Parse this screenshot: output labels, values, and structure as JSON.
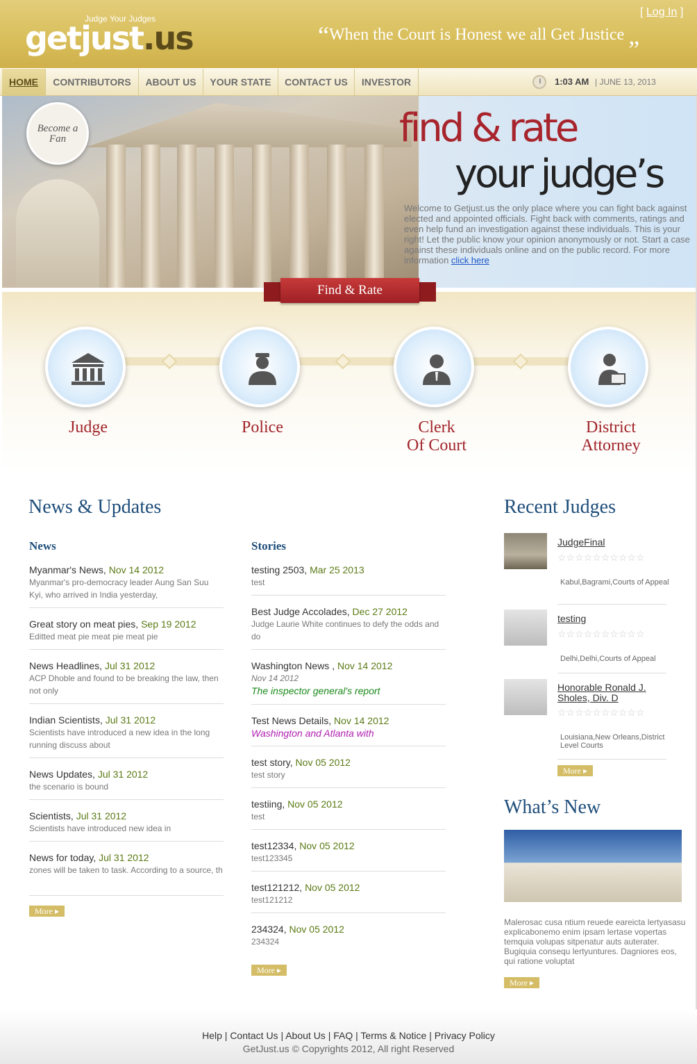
{
  "header": {
    "logo_main": "getjust",
    "logo_tld": ".us",
    "tagline": "Judge Your Judges",
    "quote_open": "“",
    "quote": "When the Court is Honest we all Get Justice",
    "quote_close": "„",
    "login_open": "[ ",
    "login": "Log In",
    "login_close": " ]"
  },
  "nav": {
    "items": [
      "HOME",
      "CONTRIBUTORS",
      "ABOUT US",
      "YOUR STATE",
      "CONTACT US",
      "INVESTOR"
    ],
    "time": "1:03 AM",
    "date": " | JUNE 13, 2013"
  },
  "hero": {
    "fan_badge": "Become a Fan",
    "headline_1": "find & rate",
    "headline_2": "your judge’s",
    "text": "Welcome to Getjust.us the only place where you can fight back against elected and appointed officials. Fight back with comments, ratings and even help fund an investigation against these individuals. This is your right! Let the public know your opinion anonymously or not. Start a case against these individuals online and on the public record. For more information ",
    "link": "click here"
  },
  "findrate": {
    "ribbon": "Find & Rate",
    "categories": [
      "Judge",
      "Police",
      "Clerk\nOf Court",
      "District\nAttorney"
    ]
  },
  "news": {
    "heading": "News & Updates",
    "news_heading": "News",
    "stories_heading": "Stories",
    "news_items": [
      {
        "title": "Myanmar's News, ",
        "date": "Nov 14 2012",
        "summary": "Myanmar's pro-democracy leader Aung San Suu Kyi, who arrived in India yesterday,"
      },
      {
        "title": "Great story on meat pies, ",
        "date": "Sep 19 2012",
        "summary": "Editted meat pie meat pie meat pie"
      },
      {
        "title": "News Headlines, ",
        "date": "Jul 31 2012",
        "summary": "ACP Dhoble and found to be breaking the law, then not only"
      },
      {
        "title": "Indian Scientists, ",
        "date": "Jul 31 2012",
        "summary": "Scientists have introduced a new idea in the long running discuss about"
      },
      {
        "title": "News Updates, ",
        "date": "Jul 31 2012",
        "summary": "the scenario is bound"
      },
      {
        "title": "Scientists, ",
        "date": "Jul 31 2012",
        "summary": "Scientists have introduced new idea in"
      },
      {
        "title": "News for today, ",
        "date": "Jul 31 2012",
        "summary": "zones will be taken to task. According to a source, th"
      }
    ],
    "story_items": [
      {
        "title": "testing 2503, ",
        "date": "Mar 25 2013",
        "summary": "test"
      },
      {
        "title": "Best Judge Accolades, ",
        "date": "Dec 27 2012",
        "summary": "Judge Laurie White continues to defy the odds and do"
      },
      {
        "title": "Washington News , ",
        "date": "Nov 14 2012",
        "summary": "Nov 14 2012",
        "summary2": "The inspector general's report"
      },
      {
        "title": "Test News Details, ",
        "date": "Nov 14 2012",
        "summary": "Washington and Atlanta with"
      },
      {
        "title": "test story, ",
        "date": "Nov 05 2012",
        "summary": "test story"
      },
      {
        "title": "testiing, ",
        "date": "Nov 05 2012",
        "summary": "test"
      },
      {
        "title": "test12334, ",
        "date": "Nov 05 2012",
        "summary": "test123345"
      },
      {
        "title": "test121212, ",
        "date": "Nov 05 2012",
        "summary": "test121212"
      },
      {
        "title": "234324, ",
        "date": "Nov 05 2012",
        "summary": "234324"
      }
    ],
    "more": "More ▸"
  },
  "judges": {
    "heading": "Recent Judges",
    "items": [
      {
        "name": "JudgeFinal",
        "location": "Kabul,Bagrami,Courts of Appeal"
      },
      {
        "name": "testing",
        "location": "Delhi,Delhi,Courts of Appeal"
      },
      {
        "name": "Honorable Ronald J. Sholes, Div. D",
        "location": "Louisiana,New Orleans,District Level Courts"
      }
    ],
    "stars": "☆☆☆☆☆☆☆☆☆☆",
    "more": "More ▸"
  },
  "whatsnew": {
    "heading": "What’s New",
    "text": "Malerosac cusa ntium reuede eareicta lertyasasu explicabonemo enim ipsam lertase vopertas temquia volupas sitpenatur auts auterater. Bugiquia consequ lertyuntures. Dagniores eos, qui ratione voluptat",
    "more": "More ▸"
  },
  "footer": {
    "links": [
      "Help",
      "Contact Us",
      "About Us",
      "FAQ",
      "Terms & Notice",
      "Privacy Policy"
    ],
    "copyright": "GetJust.us © Copyrights 2012, All right Reserved"
  }
}
